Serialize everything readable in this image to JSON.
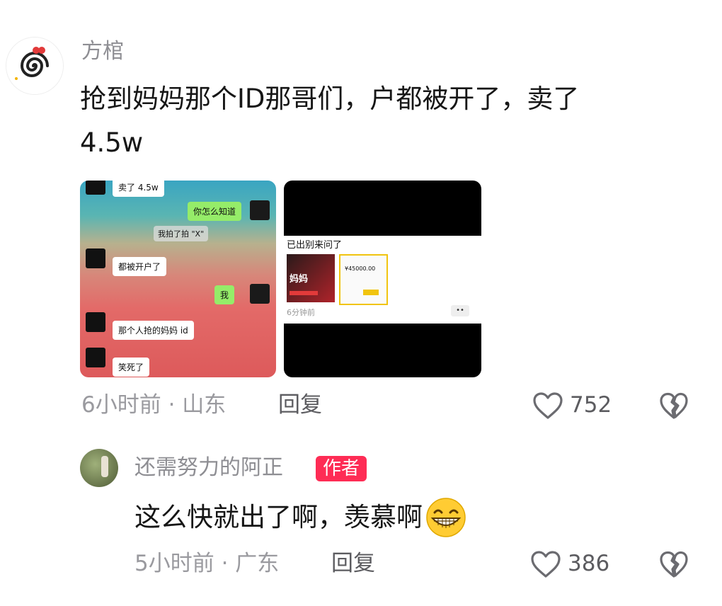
{
  "comment1": {
    "username": "方棺",
    "text_line1": "抢到妈妈那个ID那哥们，户都被开了，卖了",
    "text_line2": "4.5w",
    "meta": "6小时前 · 山东",
    "reply_label": "回复",
    "likes": "752",
    "image1": {
      "top_bubble": "卖了 4.5w",
      "bubble_q": "你怎么知道",
      "system_note": "我拍了拍 \"X\"",
      "bubble_a1": "都被开户了",
      "bubble_me": "我",
      "bubble_a2": "那个人抢的妈妈 id",
      "bubble_a3": "笑死了"
    },
    "image2": {
      "caption": "已出别来问了",
      "price": "¥45000.00",
      "card_title": "妈妈",
      "time": "6分钟前"
    }
  },
  "comment2": {
    "username": "还需努力的阿正",
    "author_badge": "作者",
    "text": "这么快就出了啊，羡慕啊",
    "meta": "5小时前 · 广东",
    "reply_label": "回复",
    "likes": "386"
  },
  "icons": {
    "like": "heart-icon",
    "dislike": "broken-heart-icon",
    "emoji": "grin-emoji-icon"
  }
}
